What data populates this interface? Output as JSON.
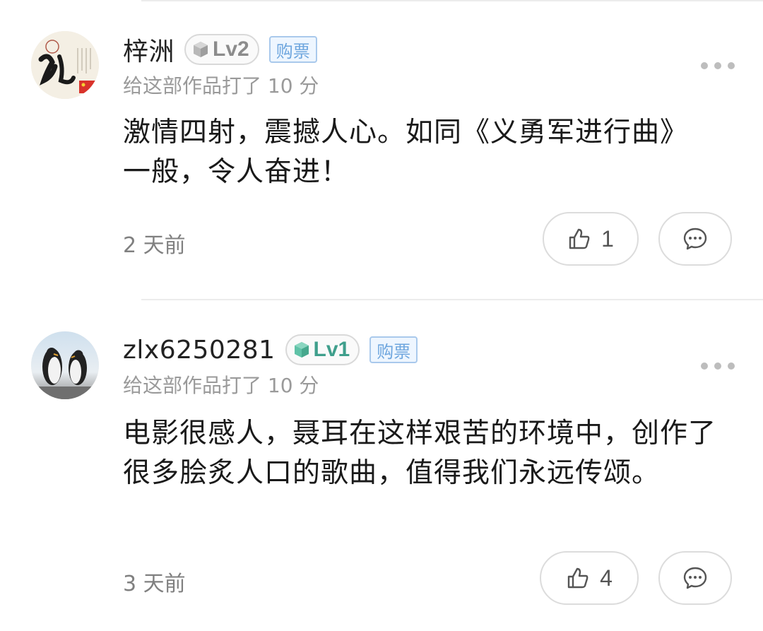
{
  "comments": [
    {
      "username": "梓洲",
      "level": "Lv2",
      "buy_badge": "购票",
      "rating_text": "给这部作品打了 10 分",
      "content": "激情四射，震撼人心。如同《义勇军进行曲》一般，令人奋进！",
      "time": "2 天前",
      "likes": "1",
      "avatar_icon": "calligraphy-avatar-icon",
      "more_icon": "more-dots-icon",
      "like_icon": "thumbs-up-icon",
      "reply_icon": "comment-bubble-icon"
    },
    {
      "username": "zlx6250281",
      "level": "Lv1",
      "buy_badge": "购票",
      "rating_text": "给这部作品打了 10 分",
      "content": "电影很感人，聂耳在这样艰苦的环境中，创作了很多脍炙人口的歌曲，值得我们永远传颂。",
      "time": "3 天前",
      "likes": "4",
      "avatar_icon": "penguin-avatar-icon",
      "more_icon": "more-dots-icon",
      "like_icon": "thumbs-up-icon",
      "reply_icon": "comment-bubble-icon"
    }
  ],
  "colors": {
    "buy_badge_text": "#6ea6de",
    "buy_badge_border": "#a9c9ec",
    "lv1_gem": "#5fc2a7",
    "lv2_gem": "#b8b8b8",
    "divider": "#ececec"
  }
}
